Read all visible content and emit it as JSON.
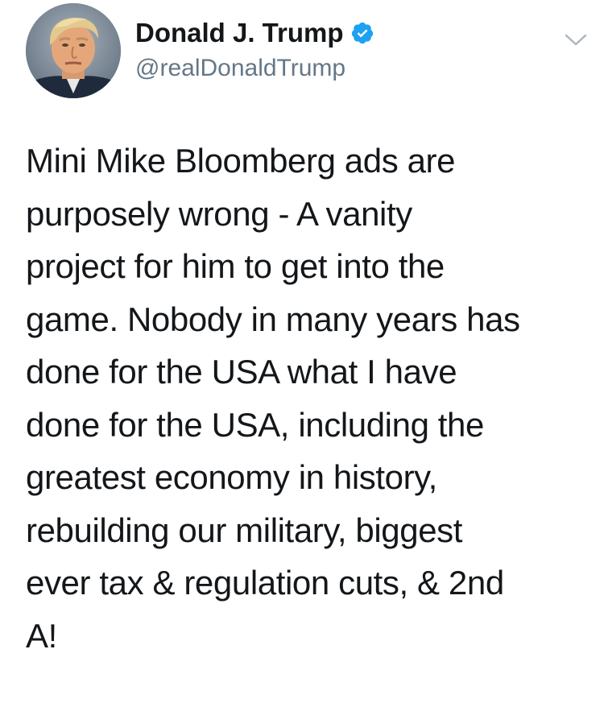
{
  "tweet": {
    "display_name": "Donald J. Trump",
    "handle": "@realDonaldTrump",
    "verified": true,
    "text": "Mini Mike Bloomberg ads are\npurposely wrong - A vanity\nproject for him to get into the\ngame. Nobody in many years has\ndone for the USA what I have\ndone for the USA, including the\ngreatest economy in history,\nrebuilding our military, biggest\never tax & regulation cuts, & 2nd\nA!"
  },
  "icons": {
    "verified": "verified-badge-icon",
    "menu": "chevron-down-icon"
  },
  "colors": {
    "text": "#14171a",
    "handle": "#657786",
    "verified": "#1da1f2",
    "chevron": "#aab8c2"
  }
}
